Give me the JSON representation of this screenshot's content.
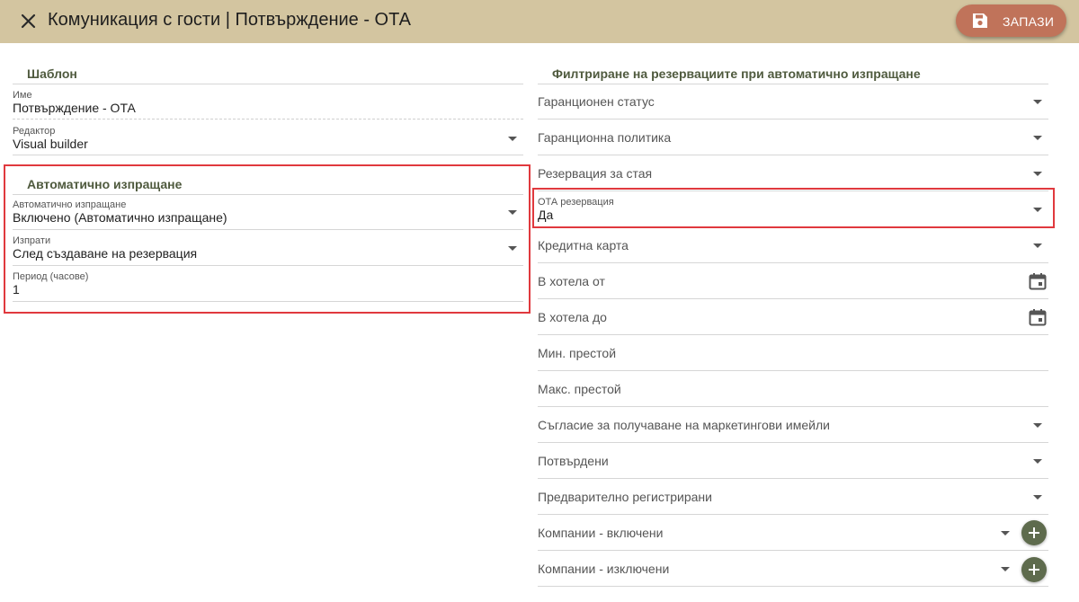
{
  "header": {
    "title": "Комуникация с гости | Потвърждение - ОТА",
    "save_label": "ЗАПАЗИ"
  },
  "template_section": {
    "title": "Шаблон",
    "name_label": "Име",
    "name_value": "Потвърждение - ОТА",
    "editor_label": "Редактор",
    "editor_value": "Visual builder"
  },
  "auto_send_section": {
    "title": "Автоматично изпращане",
    "auto_send_label": "Автоматично изпращане",
    "auto_send_value": "Включено (Автоматично изпращане)",
    "send_label": "Изпрати",
    "send_value": "След създаване на резервация",
    "period_label": "Период (часове)",
    "period_value": "1"
  },
  "filter_section": {
    "title": "Филтриране на резервациите при автоматично изпращане",
    "guarantee_status": "Гаранционен статус",
    "guarantee_policy": "Гаранционна политика",
    "room_reservation": "Резервация за стая",
    "ota_label": "ОТА резервация",
    "ota_value": "Да",
    "credit_card": "Кредитна карта",
    "in_hotel_from": "В хотела от",
    "in_hotel_to": "В хотела до",
    "min_stay": "Мин. престой",
    "max_stay": "Макс. престой",
    "marketing_consent": "Съгласие за получаване на маркетингови имейли",
    "confirmed": "Потвърдени",
    "preregistered": "Предварително регистрирани",
    "companies_included": "Компании - включени",
    "companies_excluded": "Компании - изключени"
  },
  "colors": {
    "header_bg": "#d3c5a0",
    "save_button": "#c0735a",
    "section_title": "#4f5a3e",
    "highlight": "#e0393e",
    "add_button": "#5e6b4d"
  },
  "icons": {
    "close": "close-icon",
    "save": "floppy-disk-icon",
    "dropdown": "chevron-down-icon",
    "calendar": "calendar-icon",
    "add": "plus-icon"
  }
}
